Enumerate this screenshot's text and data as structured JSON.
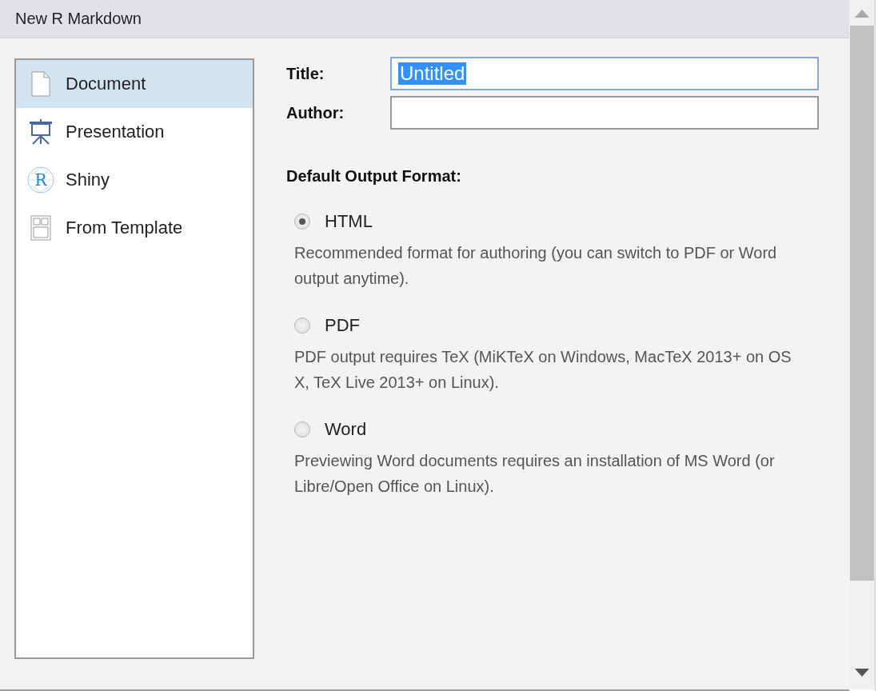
{
  "window": {
    "title": "New R Markdown"
  },
  "sidebar": {
    "items": [
      {
        "label": "Document",
        "kind": "document",
        "selected": true
      },
      {
        "label": "Presentation",
        "kind": "presentation",
        "selected": false
      },
      {
        "label": "Shiny",
        "kind": "shiny",
        "icon_letter": "R",
        "selected": false
      },
      {
        "label": "From Template",
        "kind": "template",
        "selected": false
      }
    ]
  },
  "fields": [
    {
      "label": "Title:",
      "value": "Untitled",
      "focused": true,
      "selected": true
    },
    {
      "label": "Author:",
      "focused": false
    }
  ],
  "output": {
    "heading": "Default Output Format:",
    "formats": [
      {
        "label": "HTML",
        "description": "Recommended format for authoring (you can switch to PDF or Word output anytime).",
        "selected": true
      },
      {
        "label": "PDF",
        "description": "PDF output requires TeX (MiKTeX on Windows, MacTeX 2013+ on OS X, TeX Live 2013+ on Linux).",
        "selected": false
      },
      {
        "label": "Word",
        "description": "Previewing Word documents requires an installation of MS Word (or Libre/Open Office on Linux).",
        "selected": false
      }
    ]
  }
}
